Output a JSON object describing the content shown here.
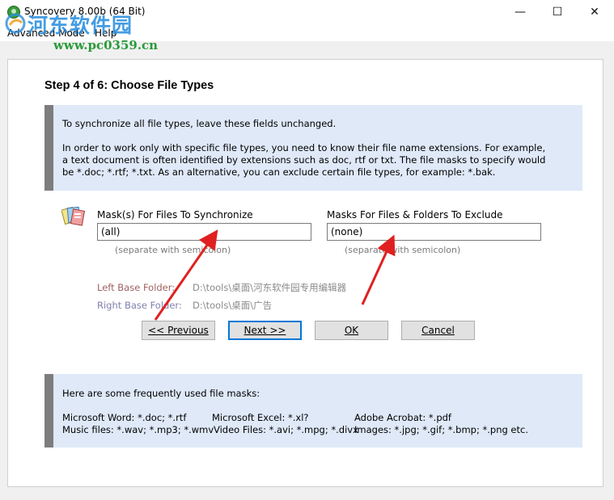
{
  "window": {
    "title": "Syncovery 8.00b (64 Bit)",
    "minimize": "—",
    "maximize": "☐",
    "close": "✕"
  },
  "menu": {
    "advanced_mode": "Advanced Mode",
    "help": "Help"
  },
  "watermark": {
    "site_name": "河东软件园",
    "url": "www.pc0359.cn"
  },
  "step": {
    "title": "Step 4 of 6: Choose File Types"
  },
  "intro": {
    "line1": "To synchronize all file types, leave these fields unchanged.",
    "line2": "In order to work only with specific file types, you need to know their file name extensions. For example,",
    "line3": "a text document is often identified by extensions such as doc, rtf or txt. The file masks to specify would",
    "line4": "be *.doc; *.rtf; *.txt. As an alternative, you can exclude certain file types, for example: *.bak."
  },
  "include": {
    "label": "Mask(s) For Files To Synchronize",
    "value": "(all)",
    "hint": "(separate with semicolon)"
  },
  "exclude": {
    "label": "Masks For Files & Folders To Exclude",
    "value": "(none)",
    "hint": "(separate with semicolon)"
  },
  "folders": {
    "left_label": "Left Base Folder:",
    "left_value": "D:\\tools\\桌面\\河东软件园专用编辑器",
    "right_label": "Right Base Folder:",
    "right_value": "D:\\tools\\桌面\\广告",
    "left_color": "#a06060",
    "right_color": "#8080b0"
  },
  "buttons": {
    "previous": "<< Previous",
    "next": "Next >>",
    "ok": "OK",
    "cancel": "Cancel"
  },
  "masks": {
    "heading": "Here are some frequently used file masks:",
    "word": "Microsoft Word: *.doc; *.rtf",
    "excel": "Microsoft Excel: *.xl?",
    "acrobat": "Adobe Acrobat: *.pdf",
    "music": "Music files: *.wav; *.mp3; *.wmv",
    "video": "Video Files: *.avi; *.mpg; *.divx",
    "images": "Images: *.jpg; *.gif; *.bmp; *.png   etc."
  },
  "colors": {
    "accent": "#0078d7",
    "info_bg": "#dfe9f8",
    "annotation_arrow": "#e02020"
  }
}
